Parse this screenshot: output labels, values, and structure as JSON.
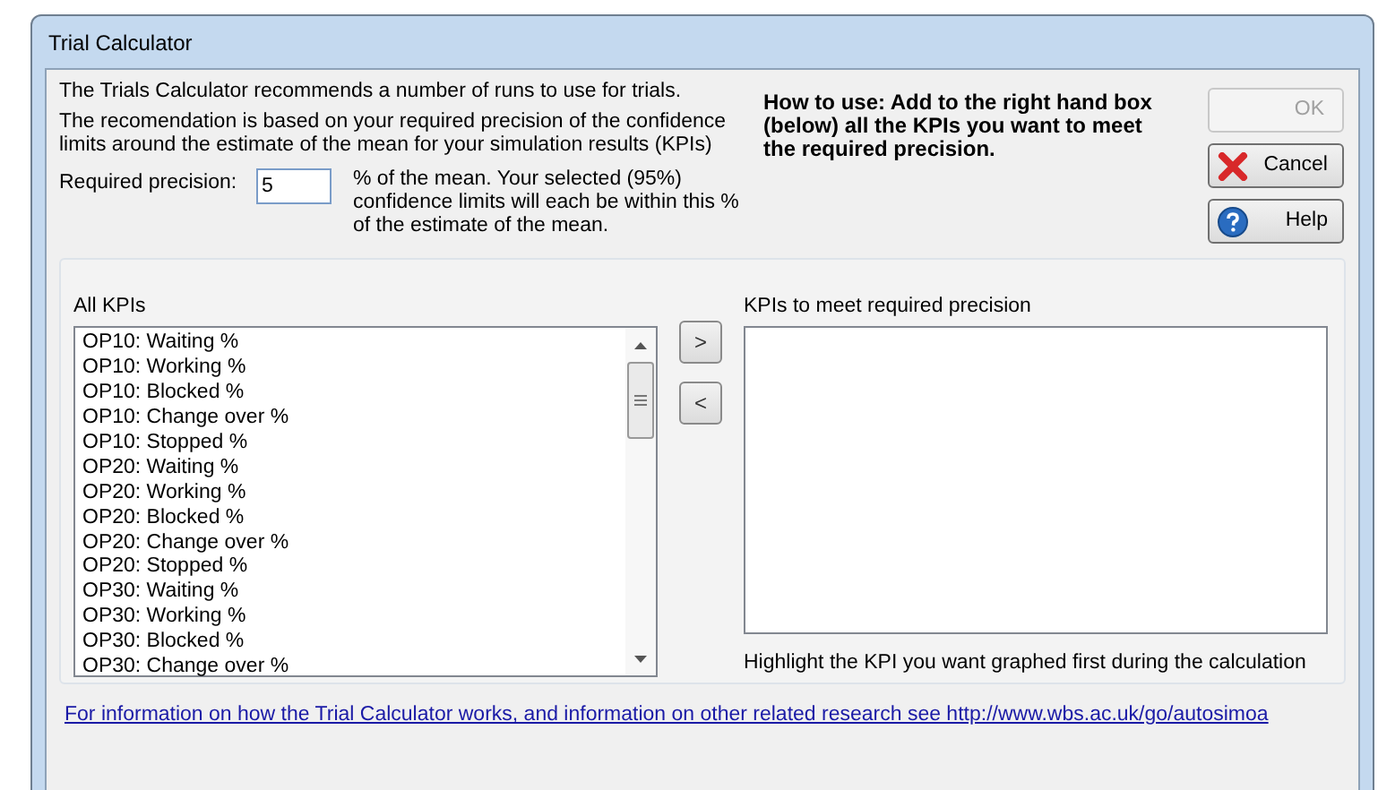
{
  "window": {
    "title": "Trial Calculator"
  },
  "intro": [
    "The Trials Calculator recommends a number of runs to use for trials.",
    "The recomendation is based on your required precision of the confidence limits around the estimate of the mean for your simulation results (KPIs)"
  ],
  "precision": {
    "label": "Required precision:",
    "value": "5",
    "note": "% of the mean.  Your selected (95%) confidence limits will each be within this % of the estimate of the mean."
  },
  "how_to_use": "How to use: Add to the right hand box (below) all the KPIs you want to meet the required precision.",
  "buttons": [
    {
      "label": "OK",
      "kind": "ok",
      "disabled": true
    },
    {
      "label": "Cancel",
      "kind": "cancel",
      "disabled": false
    },
    {
      "label": "Help",
      "kind": "help",
      "disabled": false
    }
  ],
  "all_kpis": {
    "label": "All KPIs",
    "items": [
      "OP10: Waiting %",
      "OP10: Working %",
      "OP10: Blocked %",
      "OP10: Change over %",
      "OP10: Stopped %",
      "OP20: Waiting %",
      "OP20: Working %",
      "OP20: Blocked %",
      "OP20: Change over %",
      "OP20: Stopped %",
      "OP30: Waiting %",
      "OP30: Working %",
      "OP30: Blocked %",
      "OP30: Change over %"
    ]
  },
  "move_buttons": [
    ">",
    "<"
  ],
  "selected_kpis": {
    "label": "KPIs to meet required precision",
    "hint": "Highlight the KPI you want graphed first during the calculation"
  },
  "info_link": "For information on how the Trial Calculator works, and information on other related research see http://www.wbs.ac.uk/go/autosimoa"
}
